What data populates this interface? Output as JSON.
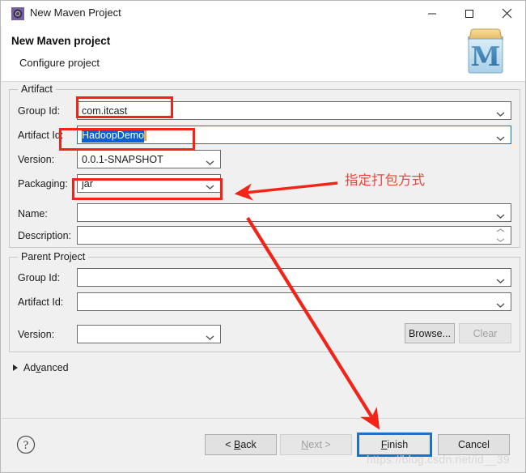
{
  "window": {
    "title": "New Maven Project",
    "icon": "maven-gear-icon",
    "controls": {
      "minimize": "minimize-icon",
      "maximize": "maximize-icon",
      "close": "close-icon"
    }
  },
  "header": {
    "title": "New Maven project",
    "subtitle": "Configure project",
    "logo": "maven-m-box-icon"
  },
  "artifact": {
    "legend": "Artifact",
    "fields": [
      {
        "label": "Group Id:",
        "value": "com.itcast",
        "control": "combo"
      },
      {
        "label": "Artifact Id:",
        "value": "HadoopDemo",
        "control": "combo"
      },
      {
        "label": "Version:",
        "value": "0.0.1-SNAPSHOT",
        "control": "combo"
      },
      {
        "label": "Packaging:",
        "value": "jar",
        "control": "combo"
      },
      {
        "label": "Name:",
        "value": "",
        "control": "combo"
      },
      {
        "label": "Description:",
        "value": "",
        "control": "textarea"
      }
    ]
  },
  "parent": {
    "legend": "Parent Project",
    "fields": [
      {
        "label": "Group Id:",
        "value": "",
        "control": "combo"
      },
      {
        "label": "Artifact Id:",
        "value": "",
        "control": "combo"
      },
      {
        "label": "Version:",
        "value": "",
        "control": "combo"
      }
    ],
    "browse_label": "Browse...",
    "clear_label": "Clear"
  },
  "advanced": {
    "label_pre": "Ad",
    "label_mn": "v",
    "label_post": "anced",
    "expanded": false
  },
  "footer": {
    "help": "help-icon",
    "back": {
      "pre": "< ",
      "mn": "B",
      "post": "ack"
    },
    "next": {
      "pre": "",
      "mn": "N",
      "post": "ext >"
    },
    "finish": {
      "pre": "",
      "mn": "F",
      "post": "inish"
    },
    "cancel": {
      "pre": "",
      "mn": "",
      "post": "Cancel"
    }
  },
  "annotations": {
    "packaging_note": "指定打包方式",
    "color": "#f22418",
    "watermark": "https://blog.csdn.net/id__39"
  }
}
